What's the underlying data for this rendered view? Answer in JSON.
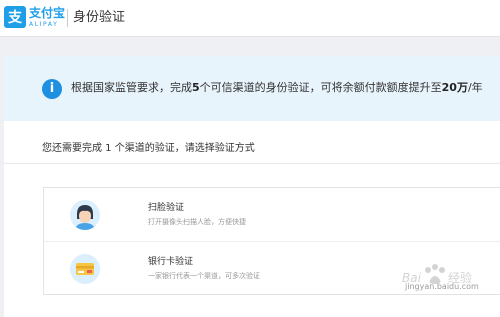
{
  "header": {
    "logo_cn": "支付宝",
    "logo_en": "ALIPAY",
    "title": "身份验证"
  },
  "notice": {
    "text_prefix": "根据国家监管要求，完成",
    "count": "5",
    "text_middle": "个可信渠道的身份验证，可将余额付款额度提升至",
    "limit": "20万",
    "text_suffix": "/年"
  },
  "prompt": "您还需要完成 1 个渠道的验证，请选择验证方式",
  "methods": [
    {
      "title": "扫脸验证",
      "desc": "打开摄像头扫描人脸，方便快捷",
      "icon": "face-scan-icon"
    },
    {
      "title": "银行卡验证",
      "desc": "一家银行代表一个渠道，可多次验证",
      "icon": "bank-card-icon"
    }
  ],
  "watermark": {
    "text": "jingyan.baidu.com"
  },
  "colors": {
    "brand": "#1e9fe8",
    "notice_bg": "#e8f4fc",
    "page_bg": "#eef0f3"
  }
}
